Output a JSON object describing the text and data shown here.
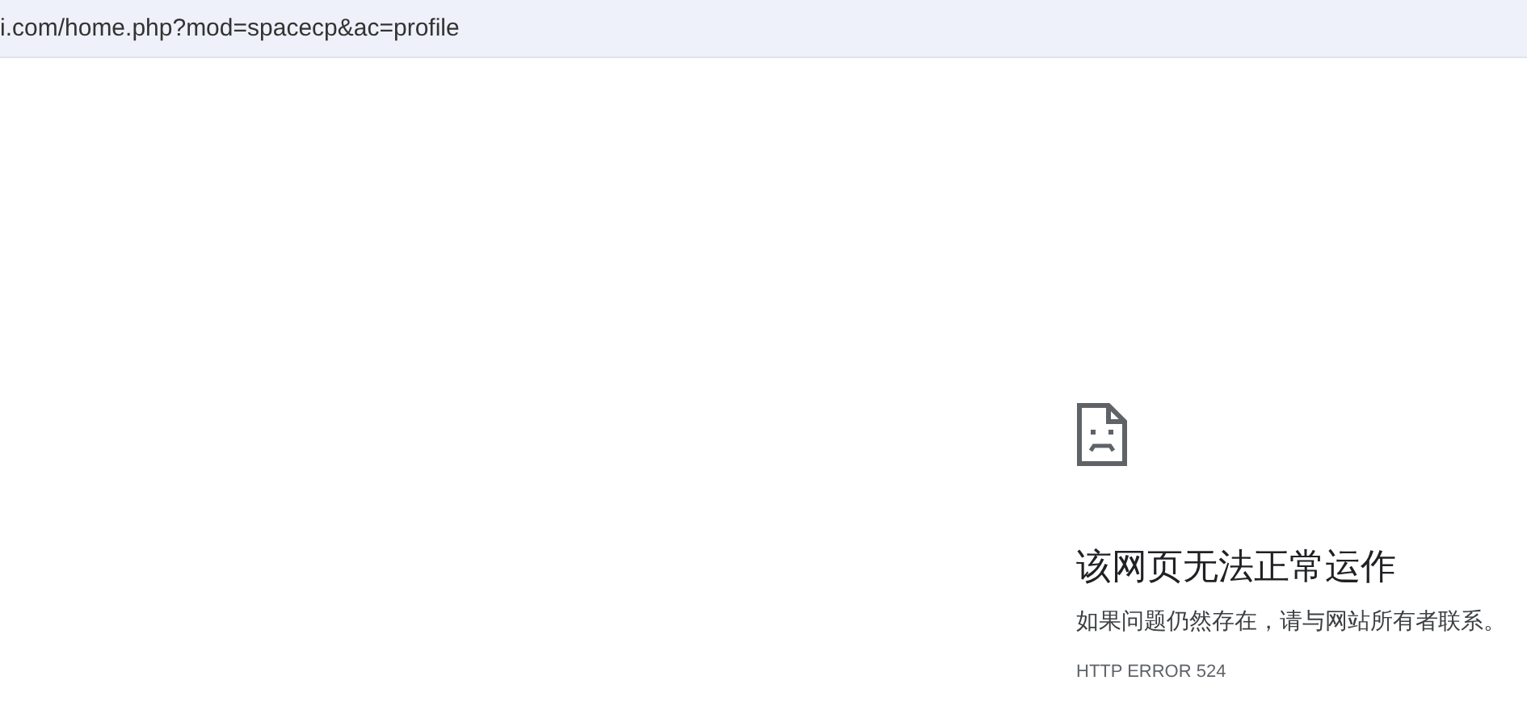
{
  "address_bar": {
    "url": "i.com/home.php?mod=spacecp&ac=profile"
  },
  "error_page": {
    "title": "该网页无法正常运作",
    "message": "如果问题仍然存在，请与网站所有者联系。",
    "code": "HTTP ERROR 524"
  }
}
